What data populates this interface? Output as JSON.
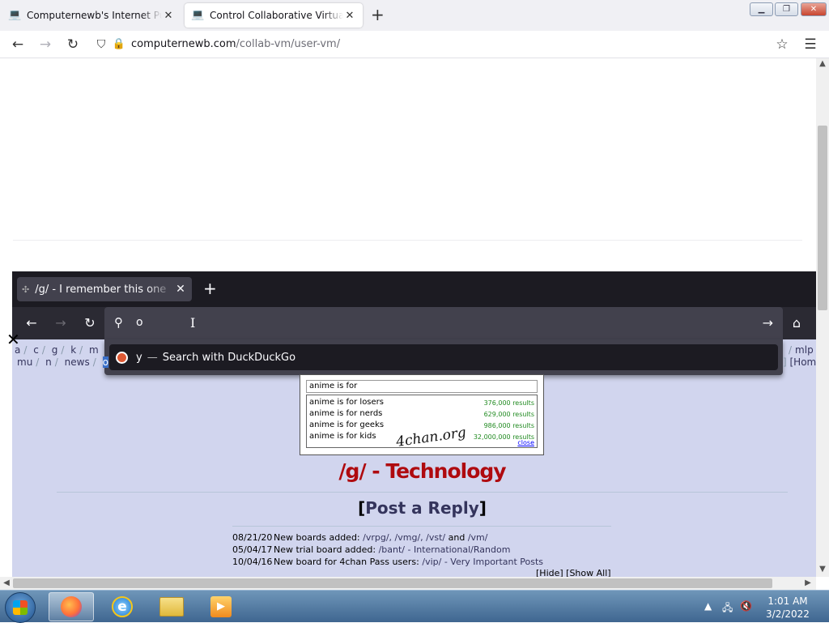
{
  "outer_browser": {
    "tabs": [
      {
        "title": "Computernewb's Internet Pub Hub",
        "favicon": "computer-icon",
        "active": false
      },
      {
        "title": "Control Collaborative Virtual Machine",
        "favicon": "computer-icon",
        "active": true
      }
    ],
    "url_domain": "computernewb.com",
    "url_path": "/collab-vm/user-vm/"
  },
  "vm_browser": {
    "tab_title": "/g/ - I remember this one",
    "address_input": "o",
    "suggestion": {
      "text": "y",
      "separator": "—",
      "action": "Search with DuckDuckGo"
    }
  },
  "board_nav": {
    "row1": [
      "a",
      "c",
      "g",
      "k",
      "m"
    ],
    "row1_right": "mlp",
    "row2": [
      "mu",
      "n",
      "news"
    ],
    "row2_highlight": "o",
    "row2_right": "[Hom"
  },
  "banner": {
    "input_text": "anime is for",
    "items": [
      {
        "text": "anime is for losers",
        "results": "376,000 results"
      },
      {
        "text": "anime is for nerds",
        "results": "629,000 results"
      },
      {
        "text": "anime is for geeks",
        "results": "986,000 results"
      },
      {
        "text": "anime is for kids",
        "results": "32,000,000 results"
      }
    ],
    "close": "close",
    "stamp": "4chan.org"
  },
  "board_title": "/g/ - Technology",
  "post_reply": {
    "open": "[",
    "label": "Post a Reply",
    "close": "]"
  },
  "news": [
    {
      "date": "08/21/20",
      "text": "New boards added: ",
      "links": "/vrpg/, /vmg/, /vst/",
      "tail_sep": " and ",
      "tail": "/vm/"
    },
    {
      "date": "05/04/17",
      "text": "New trial board added: ",
      "links": "/bant/ - International/Random",
      "tail_sep": "",
      "tail": ""
    },
    {
      "date": "10/04/16",
      "text": "New board for 4chan Pass users: ",
      "links": "/vip/ - Very Important Posts",
      "tail_sep": "",
      "tail": ""
    }
  ],
  "hide_show": "[Hide] [Show All]",
  "taskbar": {
    "time": "1:01 AM",
    "date": "3/2/2022",
    "apps": [
      "firefox-icon",
      "internet-explorer-icon",
      "file-explorer-icon",
      "media-player-icon"
    ]
  }
}
